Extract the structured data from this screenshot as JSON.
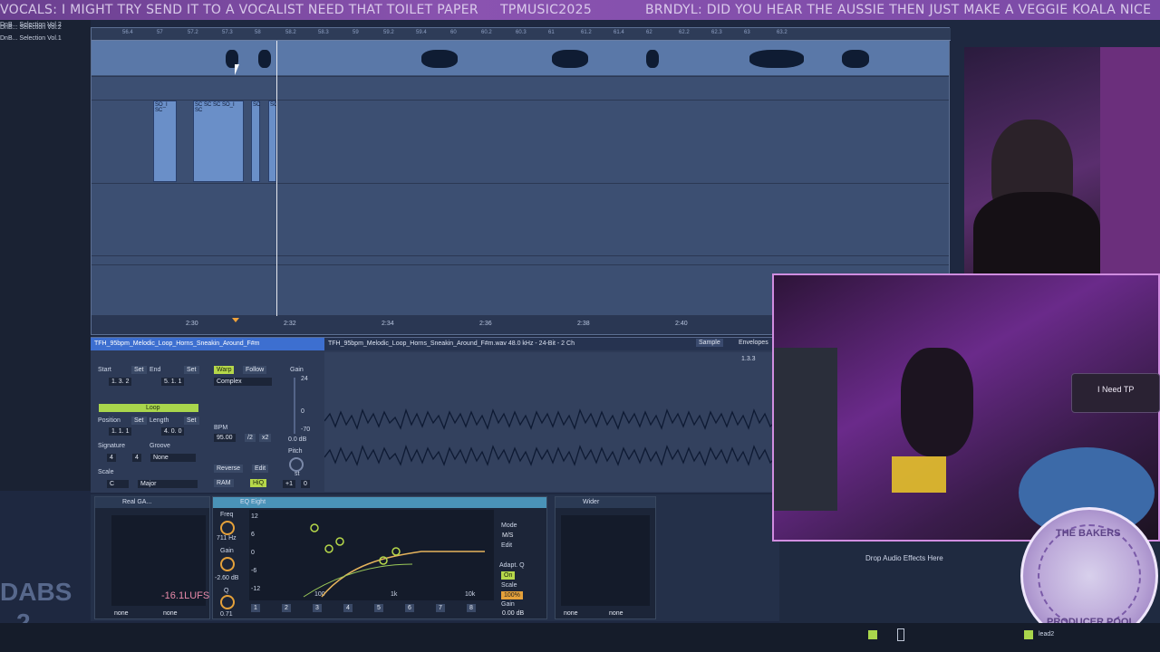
{
  "ticker": {
    "segment1": "VOCALS: I MIGHT TRY SEND IT TO A VOCALIST NEED THAT TOILET PAPER",
    "segment2": "TPMUSIC2025",
    "segment3": "BRNDYL: DID YOU HEAR THE AUSSIE THEN JUST MAKE A VEGGIE KOALA NICE"
  },
  "browser": {
    "items": [
      "DnB... Selection Vol.2",
      "DnB... Selection Vol.2",
      "DnB... Selection Vol.1"
    ]
  },
  "arrangement": {
    "ruler_ticks": [
      "56.4",
      "57",
      "57.2",
      "57.3",
      "58",
      "58.2",
      "58.3",
      "59",
      "59.2",
      "59.4",
      "60",
      "60.2",
      "60.3",
      "61",
      "61.2",
      "61.4",
      "62",
      "62.2",
      "62.3",
      "63",
      "63.2"
    ],
    "timeline": [
      "2:30",
      "2:32",
      "2:34",
      "2:36",
      "2:38",
      "2:40"
    ],
    "clip_labels": [
      "SO_I SC",
      "SC SC SC SO_I SC",
      "SC",
      "SC"
    ]
  },
  "clip_view": {
    "title": "TFH_95bpm_Melodic_Loop_Horns_Sneakin_Around_F#m",
    "info": "TFH_95bpm_Melodic_Loop_Horns_Sneakin_Around_F#m.wav  48.0 kHz - 24-Bit - 2 Ch",
    "tab_sample": "Sample",
    "tab_envelopes": "Envelopes",
    "marker": "1.3.3",
    "start_label": "Start",
    "set_label": "Set",
    "end_label": "End",
    "start_value": "1. 3. 2",
    "end_value": "5. 1. 1",
    "warp_label": "Warp",
    "follow_label": "Follow",
    "mode_value": "Complex",
    "gain_label": "Gain",
    "gain_value": "0.0 dB",
    "gain_scale_top": "24",
    "gain_scale_mid": "0",
    "gain_scale_low": "-70",
    "loop_label": "Loop",
    "position_label": "Position",
    "length_label": "Length",
    "position_value": "1. 1. 1",
    "length_value": "4. 0. 0",
    "bpm_label": "BPM",
    "bpm_value": "95.00",
    "half_label": "/2",
    "double_label": "x2",
    "signature_label": "Signature",
    "signature_num": "4",
    "signature_den": "4",
    "groove_label": "Groove",
    "groove_value": "None",
    "scale_label": "Scale",
    "scale_key": "C",
    "scale_mode": "Major",
    "reverse_label": "Reverse",
    "edit_label": "Edit",
    "ram_label": "RAM",
    "hiq_label": "HiQ",
    "pitch_label": "Pitch",
    "pitch_unit": "st",
    "pitch_value": "+1",
    "detune_value": "0"
  },
  "devices": {
    "dev1_name": "Real GA...",
    "dev1_sel1": "none",
    "dev1_sel2": "none",
    "eq_name": "EQ Eight",
    "freq_label": "Freq",
    "freq_value": "711 Hz",
    "gain_label": "Gain",
    "gain_value": "-2.60 dB",
    "q_label": "Q",
    "q_value": "0.71",
    "eq_scale": [
      "12",
      "6",
      "0",
      "-6",
      "-12"
    ],
    "eq_freqs": [
      "100",
      "1k",
      "10k"
    ],
    "bands": [
      "1",
      "2",
      "3",
      "4",
      "5",
      "6",
      "7",
      "8"
    ],
    "mode_label": "Mode",
    "mode_value": "M/S",
    "edit_label": "Edit",
    "adapt_label": "Adapt. Q",
    "adapt_value": "On",
    "scale_label": "Scale",
    "scale_value": "100%",
    "out_gain_label": "Gain",
    "out_gain_value": "0.00 dB",
    "wider_name": "Wider",
    "wider_sel1": "none",
    "wider_sel2": "none",
    "drop_text": "Drop Audio Effects Here"
  },
  "overlays": {
    "tp_popup": "I Need TP",
    "badge_top": "THE BAKERS",
    "badge_bottom": "PRODUCER POOL",
    "dabs_line1": "DABS",
    "dabs_line2": "2",
    "lufs": "-16.1LUFS",
    "track_name": "lead2"
  }
}
